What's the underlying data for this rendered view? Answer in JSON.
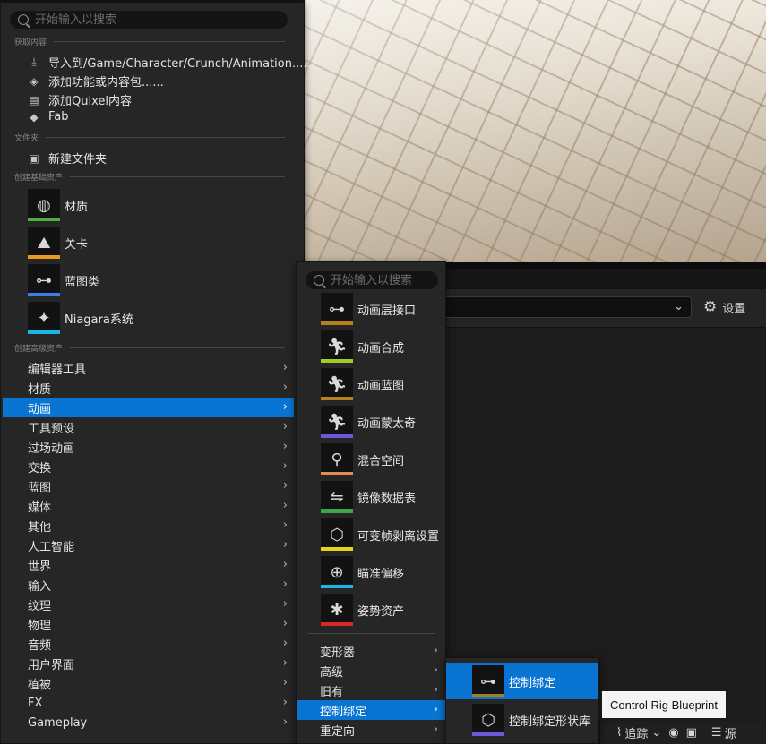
{
  "background": {
    "settings_label": "设置",
    "bottom_bar": {
      "trace_label": "追踪",
      "trailing_label": "源"
    }
  },
  "menu1": {
    "search_placeholder": "开始输入以搜索",
    "sections": {
      "get_content": "获取内容",
      "folder": "文件夹",
      "basic_assets": "创建基础资产",
      "advanced_assets": "创建高级资产"
    },
    "get_content_items": [
      {
        "label": "导入到/Game/Character/Crunch/Animation.....",
        "icon": "import-icon"
      },
      {
        "label": "添加功能或内容包......",
        "icon": "content-pack-icon"
      },
      {
        "label": "添加Quixel内容",
        "icon": "quixel-icon"
      },
      {
        "label": "Fab",
        "icon": "fab-icon"
      }
    ],
    "folder_items": [
      {
        "label": "新建文件夹",
        "icon": "new-folder-icon"
      }
    ],
    "basic_assets": [
      {
        "label": "材质",
        "icon": "material-icon",
        "stripe": "#4caf3c"
      },
      {
        "label": "关卡",
        "icon": "level-icon",
        "stripe": "#e89a1a"
      },
      {
        "label": "蓝图类",
        "icon": "blueprint-icon",
        "stripe": "#3b7ee8"
      },
      {
        "label": "Niagara系统",
        "icon": "niagara-icon",
        "stripe": "#1ab6e8"
      }
    ],
    "advanced_categories": [
      "编辑器工具",
      "材质",
      "动画",
      "工具预设",
      "过场动画",
      "交换",
      "蓝图",
      "媒体",
      "其他",
      "人工智能",
      "世界",
      "输入",
      "纹理",
      "物理",
      "音频",
      "用户界面",
      "植被",
      "FX",
      "Gameplay"
    ],
    "selected_category": "动画"
  },
  "menu2": {
    "search_placeholder": "开始输入以搜索",
    "assets": [
      {
        "label": "动画层接口",
        "icon": "anim-layer-interface-icon",
        "stripe": "#b8801c"
      },
      {
        "label": "动画合成",
        "icon": "anim-montage-icon",
        "stripe": "#9ccd2a"
      },
      {
        "label": "动画蓝图",
        "icon": "anim-blueprint-icon",
        "stripe": "#b8801c"
      },
      {
        "label": "动画蒙太奇",
        "icon": "anim-composite-icon",
        "stripe": "#6a5ad9"
      },
      {
        "label": "混合空间",
        "icon": "blend-space-icon",
        "stripe": "#e88a58"
      },
      {
        "label": "镜像数据表",
        "icon": "mirror-table-icon",
        "stripe": "#3aa84a"
      },
      {
        "label": "可变帧剥离设置",
        "icon": "frame-strip-icon",
        "stripe": "#e8d21a"
      },
      {
        "label": "瞄准偏移",
        "icon": "aim-offset-icon",
        "stripe": "#1ab6e8"
      },
      {
        "label": "姿势资产",
        "icon": "pose-asset-icon",
        "stripe": "#d8282a"
      }
    ],
    "subcategories": [
      "变形器",
      "高级",
      "旧有",
      "控制绑定",
      "重定向"
    ],
    "selected_subcategory": "控制绑定"
  },
  "menu3": {
    "items": [
      {
        "label": "控制绑定",
        "icon": "control-rig-icon",
        "stripe": "#a08020"
      },
      {
        "label": "控制绑定形状库",
        "icon": "shape-library-icon",
        "stripe": "#6a5ad9"
      }
    ]
  },
  "tooltip": {
    "text": "Control Rig Blueprint"
  }
}
